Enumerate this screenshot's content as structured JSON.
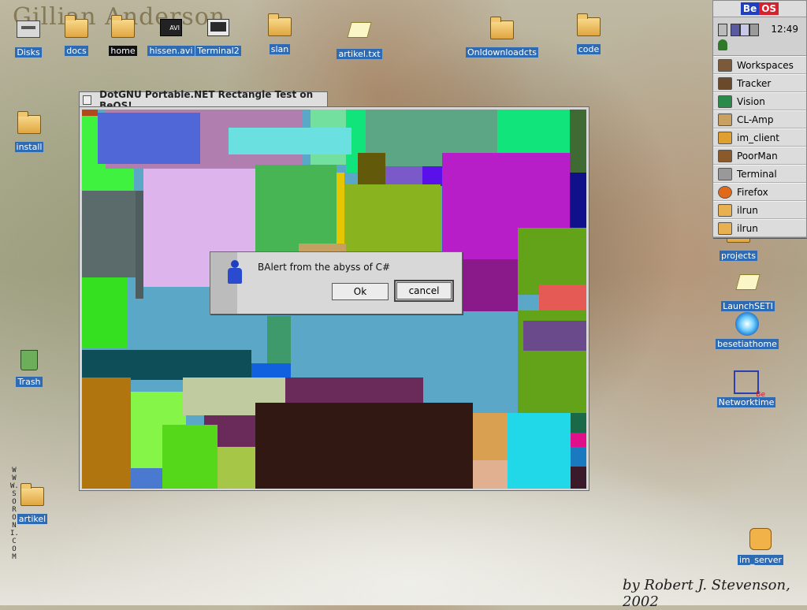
{
  "wallpaper": {
    "title_text": "Gillian Anderson",
    "signature": "by Robert J. Stevenson, 2002",
    "vertical_url": "WWW.SORONI.COM"
  },
  "desktop_icons": [
    {
      "label": "Disks",
      "icon": "disks-icon"
    },
    {
      "label": "docs",
      "icon": "folder-icon"
    },
    {
      "label": "home",
      "icon": "home-folder-icon"
    },
    {
      "label": "hissen.avi",
      "icon": "video-file-icon",
      "badge": "AVI"
    },
    {
      "label": "Terminal2",
      "icon": "terminal-icon"
    },
    {
      "label": "slan",
      "icon": "folder-icon"
    },
    {
      "label": "artikel.txt",
      "icon": "text-file-icon"
    },
    {
      "label": "Onldownloadcts",
      "icon": "folder-icon"
    },
    {
      "label": "code",
      "icon": "folder-icon"
    },
    {
      "label": "install",
      "icon": "folder-icon"
    },
    {
      "label": "Trash",
      "icon": "trash-icon"
    },
    {
      "label": "artikel",
      "icon": "folder-icon"
    },
    {
      "label": "projects",
      "icon": "folder-icon"
    },
    {
      "label": "LaunchSETI",
      "icon": "text-file-icon"
    },
    {
      "label": "besetiathome",
      "icon": "seti-icon"
    },
    {
      "label": "Networktime",
      "icon": "network-icon"
    },
    {
      "label": "im_server",
      "icon": "im-server-icon"
    }
  ],
  "deskbar": {
    "logo_be": "Be",
    "logo_os": "OS",
    "clock": "12:49",
    "items": [
      {
        "label": "Workspaces",
        "icon": "workspaces-icon",
        "color": "#7a5a3a"
      },
      {
        "label": "Tracker",
        "icon": "tracker-icon",
        "color": "#6a4a2a"
      },
      {
        "label": "Vision",
        "icon": "vision-icon",
        "color": "#2a8a4a"
      },
      {
        "label": "CL-Amp",
        "icon": "cl-amp-icon",
        "color": "#c8a060"
      },
      {
        "label": "im_client",
        "icon": "im-client-icon",
        "color": "#e0a030"
      },
      {
        "label": "PoorMan",
        "icon": "poorman-icon",
        "color": "#8a5a2a"
      },
      {
        "label": "Terminal",
        "icon": "terminal-icon",
        "color": "#999999"
      },
      {
        "label": "Firefox",
        "icon": "firefox-icon",
        "color": "#e06a1a"
      },
      {
        "label": "ilrun",
        "icon": "ilrun-icon",
        "color": "#e8b050"
      },
      {
        "label": "ilrun",
        "icon": "ilrun-icon",
        "color": "#e8b050"
      }
    ]
  },
  "window": {
    "title": "DotGNU Portable.NET Rectangle Test on BeOS!"
  },
  "alert": {
    "message": "BAlert from the abyss of C#",
    "ok_label": "Ok",
    "cancel_label": "cancel"
  }
}
